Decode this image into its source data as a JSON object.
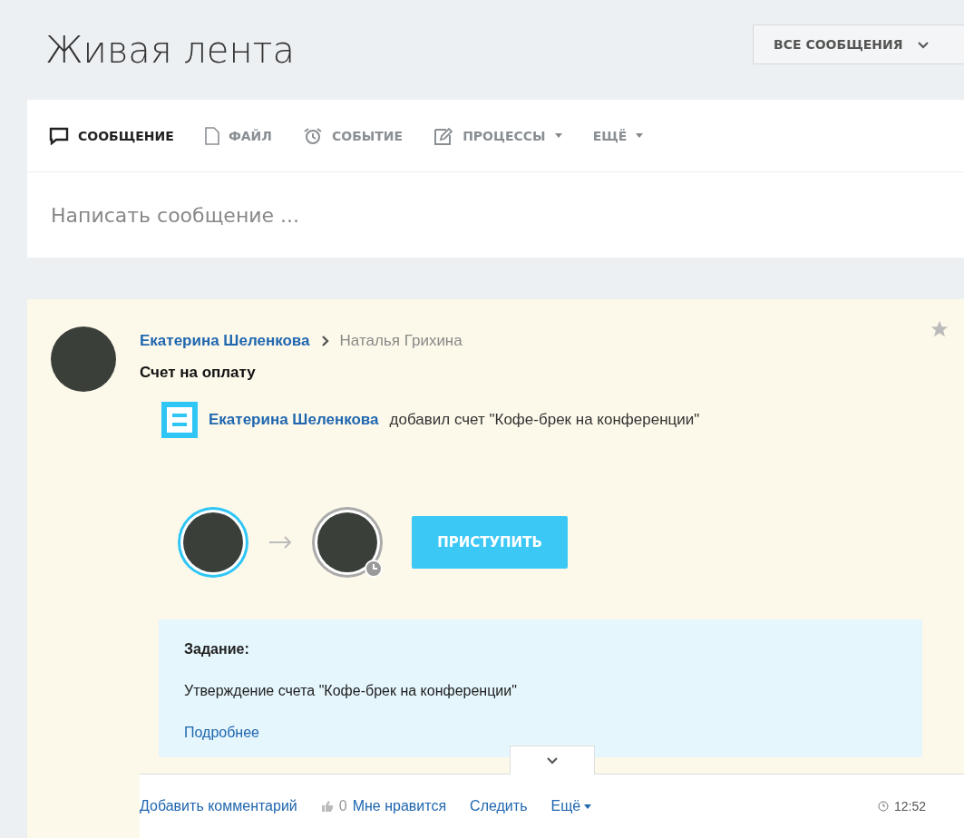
{
  "header": {
    "title": "Живая лента",
    "filter": "ВСЕ СООБЩЕНИЯ"
  },
  "composer": {
    "tabs": [
      {
        "label": "СООБЩЕНИЕ",
        "kind": "message",
        "selected": true,
        "dropdown": false
      },
      {
        "label": "ФАЙЛ",
        "kind": "file",
        "selected": false,
        "dropdown": false
      },
      {
        "label": "СОБЫТИЕ",
        "kind": "event",
        "selected": false,
        "dropdown": false
      },
      {
        "label": "ПРОЦЕССЫ",
        "kind": "process",
        "selected": false,
        "dropdown": true
      },
      {
        "label": "ЕЩЁ",
        "kind": "none",
        "selected": false,
        "dropdown": true
      }
    ],
    "placeholder": "Написать сообщение ..."
  },
  "post": {
    "author": "Екатерина Шеленкова",
    "recipient": "Наталья Грихина",
    "starred": false,
    "title": "Счет на оплату",
    "activity": {
      "actor": "Екатерина Шеленкова",
      "text": "добавил счет \"Кофе-брек на конференции\""
    },
    "action": "ПРИСТУПИТЬ",
    "task": {
      "heading": "Задание:",
      "text": "Утверждение счета \"Кофе-брек на конференции\"",
      "link": "Подробнее"
    },
    "footer": {
      "comment": "Добавить комментарий",
      "likes": "0",
      "like": "Мне нравится",
      "follow": "Следить",
      "more": "Ещё",
      "time": "12:52"
    }
  }
}
